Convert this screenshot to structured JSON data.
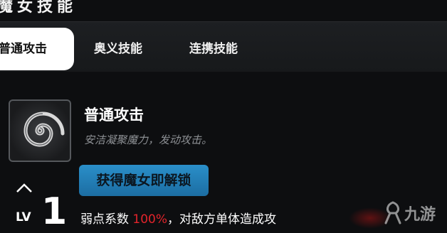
{
  "panel": {
    "title": "魔女技能"
  },
  "tabs": [
    {
      "label": "普通攻击",
      "active": true
    },
    {
      "label": "奥义技能",
      "active": false
    },
    {
      "label": "连携技能",
      "active": false
    }
  ],
  "skill": {
    "name": "普通攻击",
    "description": "安洁凝聚魔力，发动攻击。",
    "unlock_label": "获得魔女即解锁",
    "icon": "swirl-icon"
  },
  "level": {
    "label": "LV",
    "value": "1"
  },
  "effect": {
    "prefix": "弱点系数 ",
    "highlight": "100%",
    "suffix": "，对敌方单体造成攻",
    "highlight_color": "#e3242b"
  },
  "watermark": {
    "text": "九游"
  },
  "colors": {
    "accent": "#2a8fc9",
    "background": "#0d0e10"
  }
}
